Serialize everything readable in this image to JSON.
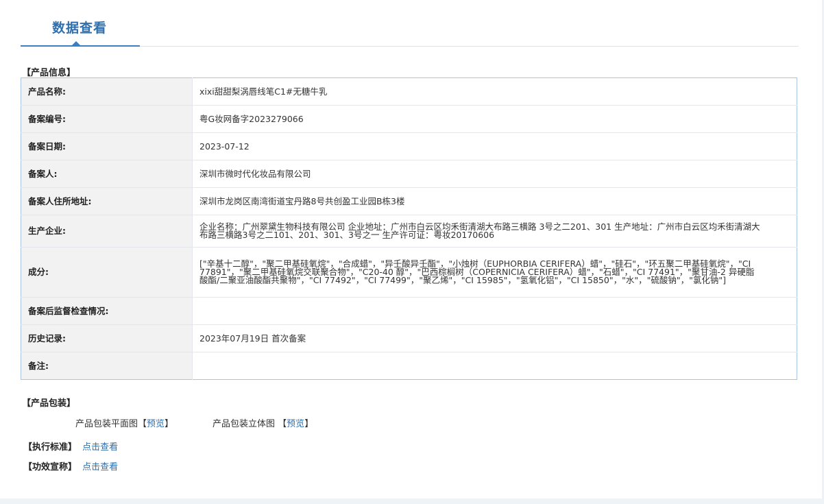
{
  "header": {
    "tab_title": "数据查看"
  },
  "sections": {
    "product_info": "【产品信息】",
    "packaging": "【产品包装】",
    "standard": "【执行标准】",
    "efficacy": "【功效宣称】"
  },
  "product_info": {
    "rows": [
      {
        "label": "产品名称:",
        "value": "xixi甜甜梨涡唇线笔C1#无糖牛乳"
      },
      {
        "label": "备案编号:",
        "value": "粤G妆网备字2023279066"
      },
      {
        "label": "备案日期:",
        "value": "2023-07-12"
      },
      {
        "label": "备案人:",
        "value": "深圳市微时代化妆品有限公司"
      },
      {
        "label": "备案人住所地址:",
        "value": "深圳市龙岗区南湾街道宝丹路8号共创盈工业园B栋3楼"
      },
      {
        "label": "生产企业:",
        "value": "企业名称：广州翠黛生物科技有限公司 企业地址：广州市白云区均禾街清湖大布路三横路 3号之二201、301 生产地址：广州市白云区均禾街清湖大布路三横路3号之二101、201、301、3号之一 生产许可证：粤妆20170606"
      },
      {
        "label": "成分:",
        "value": "[\"辛基十二醇\"，\"聚二甲基硅氧烷\"，\"合成蜡\"，\"异壬酸异壬酯\"，\"小烛树（EUPHORBIA CERIFERA）蜡\"，\"硅石\"，\"环五聚二甲基硅氧烷\"，\"CI 77891\"，\"聚二甲基硅氧烷交联聚合物\"，\"C20-40 醇\"，\"巴西棕榈树（COPERNICIA CERIFERA）蜡\"，\"石蜡\"，\"CI 77491\"，\"聚甘油-2 异硬脂酸酯/二聚亚油酸酯共聚物\"，\"CI 77492\"，\"CI 77499\"，\"聚乙烯\"，\"CI 15985\"，\"氢氧化铝\"，\"CI 15850\"，\"水\"，\"硫酸钠\"，\"氯化钠\"]"
      },
      {
        "label": "备案后监督检查情况:",
        "value": ""
      },
      {
        "label": "历史记录:",
        "value": "2023年07月19日 首次备案"
      },
      {
        "label": "备注:",
        "value": ""
      }
    ]
  },
  "packaging": {
    "flat_label": "产品包装平面图",
    "flat_link": "预览",
    "stereo_label": "产品包装立体图",
    "stereo_link": "预览",
    "bracket_open": "【",
    "bracket_close": "】"
  },
  "standard": {
    "link": "点击查看"
  },
  "efficacy": {
    "link": "点击查看"
  }
}
